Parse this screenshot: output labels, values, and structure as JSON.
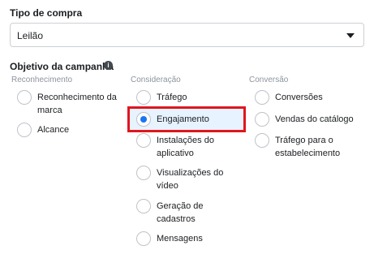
{
  "purchase_type": {
    "label": "Tipo de compra",
    "selected": "Leilão"
  },
  "objective": {
    "label": "Objetivo da campanha",
    "info_icon": "i",
    "columns": [
      {
        "header": "Reconhecimento",
        "options": [
          {
            "label": "Reconhecimento da marca",
            "checked": false
          },
          {
            "label": "Alcance",
            "checked": false
          }
        ]
      },
      {
        "header": "Consideração",
        "options": [
          {
            "label": "Tráfego",
            "checked": false
          },
          {
            "label": "Engajamento",
            "checked": true
          },
          {
            "label": "Instalações do aplicativo",
            "checked": false
          },
          {
            "label": "Visualizações do vídeo",
            "checked": false
          },
          {
            "label": "Geração de cadastros",
            "checked": false
          },
          {
            "label": "Mensagens",
            "checked": false
          }
        ]
      },
      {
        "header": "Conversão",
        "options": [
          {
            "label": "Conversões",
            "checked": false
          },
          {
            "label": "Vendas do catálogo",
            "checked": false
          },
          {
            "label": "Tráfego para o estabelecimento",
            "checked": false
          }
        ]
      }
    ]
  },
  "colors": {
    "accent": "#1877f2",
    "highlight_border": "#e0161e",
    "selected_bg": "#e7f3ff"
  }
}
